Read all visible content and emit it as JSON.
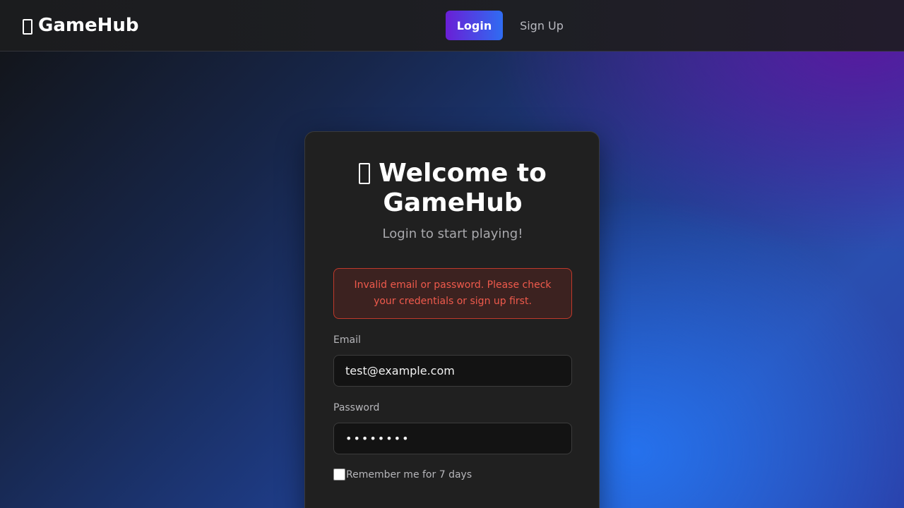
{
  "nav": {
    "logo_icon": "gamepad-icon",
    "logo_text": "GameHub",
    "login_label": "Login",
    "signup_label": "Sign Up"
  },
  "card": {
    "title_icon": "gamepad-icon",
    "title": "Welcome to GameHub",
    "subtitle": "Login to start playing!",
    "error_message": "Invalid email or password. Please check your credentials or sign up first.",
    "email_label": "Email",
    "email_value": "test@example.com",
    "password_label": "Password",
    "password_value": "••••••••",
    "remember_label": "Remember me for 7 days",
    "remember_checked": false
  },
  "colors": {
    "accent_gradient_start": "#6a1fd6",
    "accent_gradient_end": "#2f6cf2",
    "error": "#ef5a4c",
    "card_bg": "#202020"
  }
}
